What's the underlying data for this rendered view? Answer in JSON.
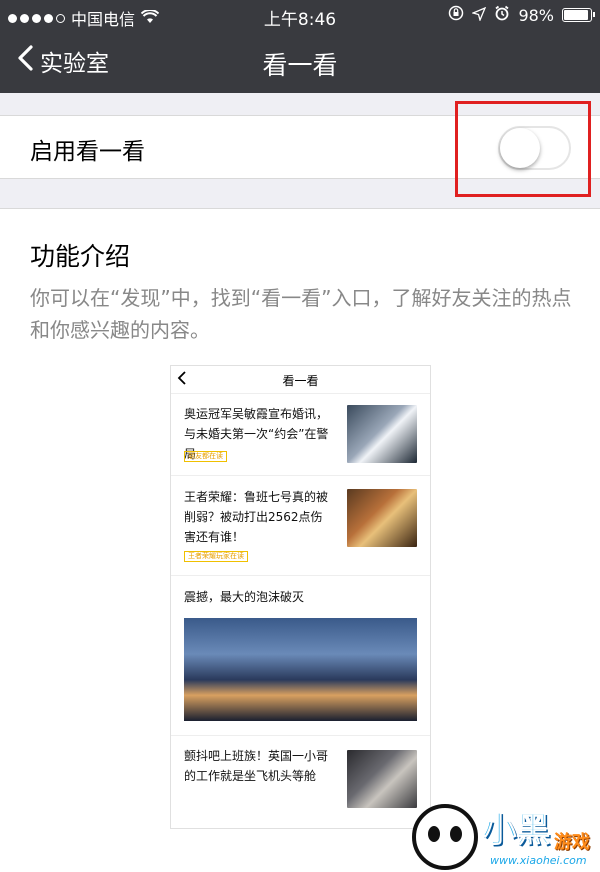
{
  "status_bar": {
    "carrier": "中国电信",
    "time": "上午8:46",
    "battery": "98%",
    "signal_bars": 4
  },
  "nav": {
    "back_label": "实验室",
    "title": "看一看"
  },
  "settings": {
    "toggle_label": "启用看一看",
    "toggle_on": false
  },
  "intro": {
    "heading": "功能介绍",
    "description": "你可以在“发现”中，找到“看一看”入口，了解好友关注的热点和你感兴趣的内容。"
  },
  "preview": {
    "title": "看一看",
    "items": [
      {
        "text": "奥运冠军吴敏霞宣布婚讯，与未婚夫第一次“约会”在警局",
        "tag": "朋友都在读"
      },
      {
        "text": "王者荣耀：鲁班七号真的被削弱？被动打出2562点伤害还有谁！",
        "tag": "王者荣耀玩家在读"
      },
      {
        "text": "震撼，最大的泡沫破灭"
      },
      {
        "text": "颤抖吧上班族！英国一小哥的工作就是坐飞机头等舱"
      }
    ]
  },
  "watermark": {
    "name": "小黑",
    "sub": "游戏",
    "url": "www.xiaohei.com"
  },
  "colors": {
    "nav_bg": "#393a3f",
    "highlight_box": "#e02020"
  }
}
